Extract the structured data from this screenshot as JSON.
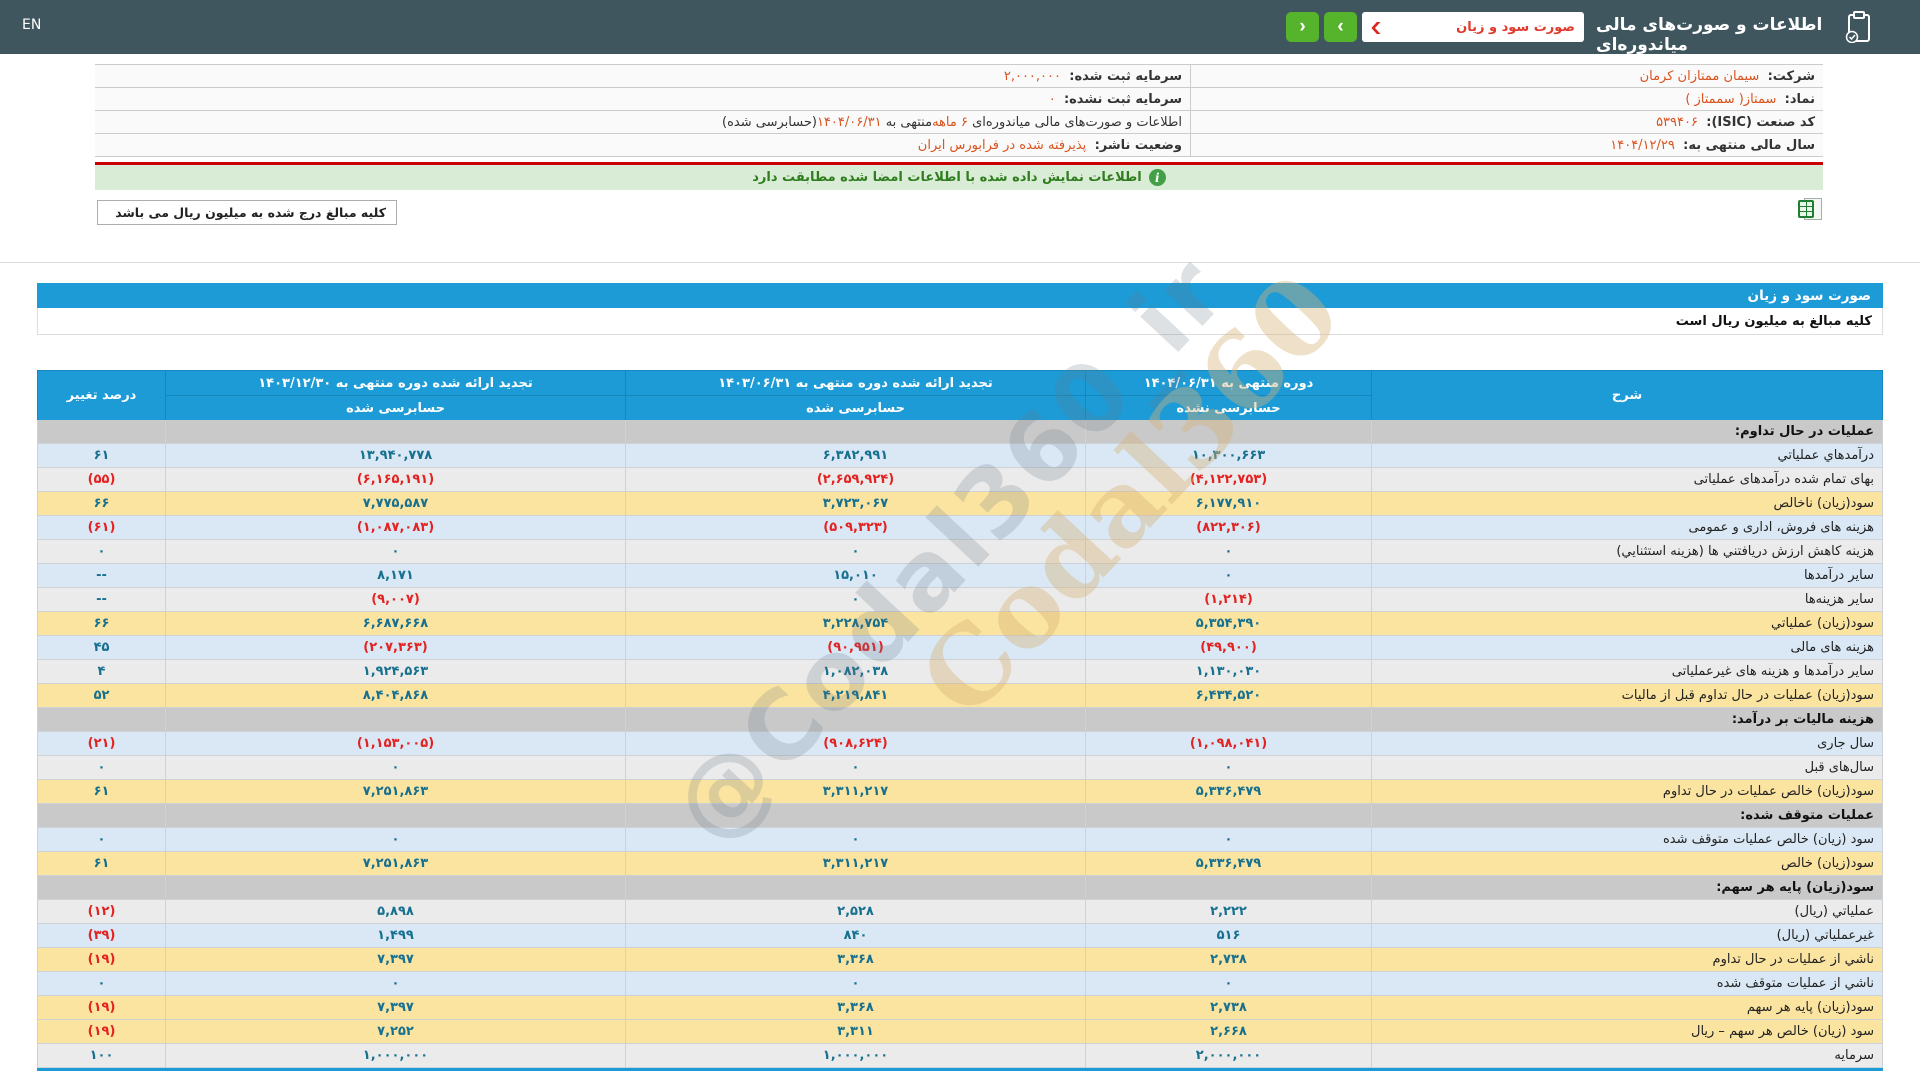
{
  "topbar": {
    "en_link": "EN",
    "title": "اطلاعات و صورت‌های مالی میاندوره‌ای",
    "statement_select_value": "صورت سود و زیان",
    "prev_arrow": "‹",
    "next_arrow": "›"
  },
  "info_table": {
    "right_rows": [
      {
        "parts": [
          {
            "t": "شرکت:",
            "c": "label"
          },
          {
            "t": "  سیمان ممتازان کرمان",
            "c": "value"
          }
        ]
      },
      {
        "parts": [
          {
            "t": "نماد:",
            "c": "label"
          },
          {
            "t": "  سمتاز( سممتاز )",
            "c": "value"
          }
        ]
      },
      {
        "parts": [
          {
            "t": "کد صنعت (ISIC):",
            "c": "label"
          },
          {
            "t": "  ۵۳۹۴۰۶",
            "c": "value"
          }
        ]
      },
      {
        "parts": [
          {
            "t": "سال مالی منتهی به:",
            "c": "label"
          },
          {
            "t": "  ۱۴۰۴/۱۲/۲۹",
            "c": "value"
          }
        ]
      }
    ],
    "left_rows": [
      {
        "parts": [
          {
            "t": "سرمایه ثبت شده:",
            "c": "label"
          },
          {
            "t": "  ۲,۰۰۰,۰۰۰",
            "c": "value"
          }
        ]
      },
      {
        "parts": [
          {
            "t": "سرمایه ثبت نشده:",
            "c": "label"
          },
          {
            "t": "  ۰",
            "c": "value"
          }
        ]
      },
      {
        "parts": [
          {
            "t": "اطلاعات و صورت‌های مالی میاندوره‌ای ",
            "c": "dark"
          },
          {
            "t": "۶ ماهه",
            "c": "value"
          },
          {
            "t": "منتهی به ",
            "c": "dark"
          },
          {
            "t": "۱۴۰۴/۰۶/۳۱",
            "c": "value"
          },
          {
            "t": "(حسابرسی شده)",
            "c": "dark"
          }
        ]
      },
      {
        "parts": [
          {
            "t": "وضعیت ناشر:",
            "c": "label"
          },
          {
            "t": "  پذیرفته شده در فرابورس ایران",
            "c": "value"
          }
        ]
      }
    ]
  },
  "banner": {
    "icon": "i",
    "text": "اطلاعات نمایش داده شده با اطلاعات امضا شده مطابقت دارد"
  },
  "units_box_label": "کلیه مبالغ درج شده به میلیون ریال می باشد",
  "statement": {
    "title": "صورت سود و زیان",
    "units_note": "کلیه مبالغ به میلیون ریال است"
  },
  "table": {
    "headers": {
      "desc": "شرح",
      "col_current": "دوره منتهی به ۱۴۰۴/۰۶/۳۱",
      "col_current_sub": "حسابرسی نشده",
      "col_mid": "تجدید ارائه شده دوره منتهی به ۱۴۰۳/۰۶/۳۱",
      "col_mid_sub": "حسابرسی شده",
      "col_year": "تجدید ارائه شده دوره منتهی به ۱۴۰۳/۱۲/۳۰",
      "col_year_sub": "حسابرسی شده",
      "pct": "درصد تغییر"
    },
    "rows": [
      {
        "label": "عملیات در حال تداوم:",
        "v1": "",
        "v2": "",
        "v3": "",
        "pct": "",
        "style": "section"
      },
      {
        "label": "درآمدهاي عملياتي",
        "v1": "۱۰,۳۰۰,۶۶۳",
        "v2": "۶,۳۸۲,۹۹۱",
        "v3": "۱۳,۹۴۰,۷۷۸",
        "pct": "۶۱",
        "style": "blue"
      },
      {
        "label": "بهای تمام شده درآمدهای عملیاتی",
        "v1": "(۴,۱۲۲,۷۵۳)",
        "v2": "(۲,۶۵۹,۹۲۴)",
        "v3": "(۶,۱۶۵,۱۹۱)",
        "pct": "(۵۵)",
        "style": "gray"
      },
      {
        "label": "سود(زيان) ناخالص",
        "v1": "۶,۱۷۷,۹۱۰",
        "v2": "۳,۷۲۳,۰۶۷",
        "v3": "۷,۷۷۵,۵۸۷",
        "pct": "۶۶",
        "style": "yellow"
      },
      {
        "label": "هزينه های فروش، اداری و عمومی",
        "v1": "(۸۲۲,۳۰۶)",
        "v2": "(۵۰۹,۳۲۳)",
        "v3": "(۱,۰۸۷,۰۸۳)",
        "pct": "(۶۱)",
        "style": "blue"
      },
      {
        "label": "هزينه کاهش ارزش دريافتني ها (هزينه استثنايي)",
        "v1": "۰",
        "v2": "۰",
        "v3": "۰",
        "pct": "۰",
        "style": "gray"
      },
      {
        "label": "ساير درآمدها",
        "v1": "۰",
        "v2": "۱۵,۰۱۰",
        "v3": "۸,۱۷۱",
        "pct": "--",
        "style": "blue"
      },
      {
        "label": "سایر هزینه‌ها",
        "v1": "(۱,۲۱۴)",
        "v2": "۰",
        "v3": "(۹,۰۰۷)",
        "pct": "--",
        "style": "gray"
      },
      {
        "label": "سود(زيان) عملياتي",
        "v1": "۵,۳۵۴,۳۹۰",
        "v2": "۳,۲۲۸,۷۵۴",
        "v3": "۶,۶۸۷,۶۶۸",
        "pct": "۶۶",
        "style": "yellow"
      },
      {
        "label": "هزينه های مالی",
        "v1": "(۴۹,۹۰۰)",
        "v2": "(۹۰,۹۵۱)",
        "v3": "(۲۰۷,۳۶۳)",
        "pct": "۴۵",
        "style": "blue"
      },
      {
        "label": "ساير درآمدها و هزينه های غيرعملياتی",
        "v1": "۱,۱۳۰,۰۳۰",
        "v2": "۱,۰۸۲,۰۳۸",
        "v3": "۱,۹۲۴,۵۶۳",
        "pct": "۴",
        "style": "gray"
      },
      {
        "label": "سود(زيان) عمليات در حال تداوم قبل از ماليات",
        "v1": "۶,۴۳۴,۵۲۰",
        "v2": "۴,۲۱۹,۸۴۱",
        "v3": "۸,۴۰۴,۸۶۸",
        "pct": "۵۲",
        "style": "yellow"
      },
      {
        "label": "هزينه ماليات بر درآمد:",
        "v1": "",
        "v2": "",
        "v3": "",
        "pct": "",
        "style": "section"
      },
      {
        "label": "سال جاری",
        "v1": "(۱,۰۹۸,۰۴۱)",
        "v2": "(۹۰۸,۶۲۴)",
        "v3": "(۱,۱۵۳,۰۰۵)",
        "pct": "(۲۱)",
        "style": "blue"
      },
      {
        "label": "سال‌های قبل",
        "v1": "۰",
        "v2": "۰",
        "v3": "۰",
        "pct": "۰",
        "style": "gray"
      },
      {
        "label": "سود(زيان) خالص عمليات در حال تداوم",
        "v1": "۵,۳۳۶,۴۷۹",
        "v2": "۳,۳۱۱,۲۱۷",
        "v3": "۷,۲۵۱,۸۶۳",
        "pct": "۶۱",
        "style": "yellow"
      },
      {
        "label": "عملیات متوقف شده:",
        "v1": "",
        "v2": "",
        "v3": "",
        "pct": "",
        "style": "section"
      },
      {
        "label": "سود (زيان) خالص عمليات متوقف شده",
        "v1": "۰",
        "v2": "۰",
        "v3": "۰",
        "pct": "۰",
        "style": "blue"
      },
      {
        "label": "سود(زيان) خالص",
        "v1": "۵,۳۳۶,۴۷۹",
        "v2": "۳,۳۱۱,۲۱۷",
        "v3": "۷,۲۵۱,۸۶۳",
        "pct": "۶۱",
        "style": "yellow"
      },
      {
        "label": "سود(زيان) پايه هر سهم:",
        "v1": "",
        "v2": "",
        "v3": "",
        "pct": "",
        "style": "section"
      },
      {
        "label": "عملياتي (ريال)",
        "v1": "۲,۲۲۲",
        "v2": "۲,۵۲۸",
        "v3": "۵,۸۹۸",
        "pct": "(۱۲)",
        "style": "gray"
      },
      {
        "label": "غيرعملياتي (ريال)",
        "v1": "۵۱۶",
        "v2": "۸۴۰",
        "v3": "۱,۴۹۹",
        "pct": "(۳۹)",
        "style": "blue"
      },
      {
        "label": "ناشي از عمليات در حال تداوم",
        "v1": "۲,۷۳۸",
        "v2": "۳,۳۶۸",
        "v3": "۷,۳۹۷",
        "pct": "(۱۹)",
        "style": "yellow"
      },
      {
        "label": "ناشي از عمليات متوقف شده",
        "v1": "۰",
        "v2": "۰",
        "v3": "۰",
        "pct": "۰",
        "style": "blue"
      },
      {
        "label": "سود(زيان) پايه هر سهم",
        "v1": "۲,۷۳۸",
        "v2": "۳,۳۶۸",
        "v3": "۷,۳۹۷",
        "pct": "(۱۹)",
        "style": "yellow"
      },
      {
        "label": "سود (زيان) خالص هر سهم – ريال",
        "v1": "۲,۶۶۸",
        "v2": "۳,۳۱۱",
        "v3": "۷,۲۵۲",
        "pct": "(۱۹)",
        "style": "yellow"
      },
      {
        "label": "سرمايه",
        "v1": "۲,۰۰۰,۰۰۰",
        "v2": "۱,۰۰۰,۰۰۰",
        "v3": "۱,۰۰۰,۰۰۰",
        "pct": "۱۰۰",
        "style": "gray"
      }
    ]
  },
  "watermark": {
    "gray": "@Codal360_ir",
    "tan": "Codal360"
  },
  "colors": {
    "topbar": "#40565f",
    "accent_blue": "#1d9bd6",
    "nav_green": "#56b32c",
    "value_teal": "#17708f",
    "negative_red": "#e32222",
    "orange_value": "#d9541e",
    "row_blue": "#d9e8f4",
    "row_gray": "#ebebeb",
    "row_yellow": "#fbe4a0",
    "row_section": "#c9c9c9",
    "banner_green": "#d9ecd5",
    "banner_border_red": "#cb0000"
  }
}
